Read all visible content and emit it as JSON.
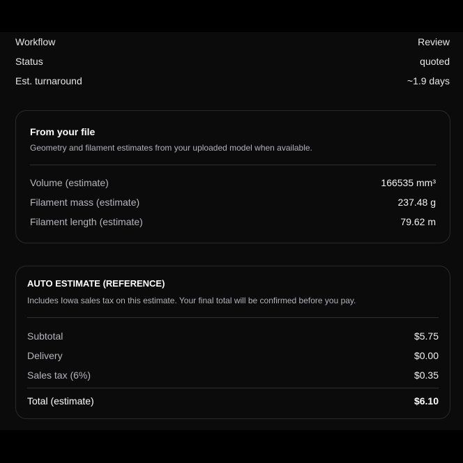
{
  "summary": {
    "rows": [
      {
        "label": "Workflow",
        "value": "Review"
      },
      {
        "label": "Status",
        "value": "quoted"
      },
      {
        "label": "Est. turnaround",
        "value": "~1.9 days"
      }
    ]
  },
  "file_card": {
    "title": "From your file",
    "subtitle": "Geometry and filament estimates from your uploaded model when available.",
    "rows": [
      {
        "label": "Volume (estimate)",
        "value": "166535 mm³"
      },
      {
        "label": "Filament mass (estimate)",
        "value": "237.48 g"
      },
      {
        "label": "Filament length (estimate)",
        "value": "79.62 m"
      }
    ]
  },
  "estimate_card": {
    "title": "AUTO ESTIMATE (REFERENCE)",
    "subtitle": "Includes Iowa sales tax on this estimate. Your final total will be confirmed before you pay.",
    "rows": [
      {
        "label": "Subtotal",
        "value": "$5.75"
      },
      {
        "label": "Delivery",
        "value": "$0.00"
      },
      {
        "label": "Sales tax (6%)",
        "value": "$0.35"
      }
    ],
    "total": {
      "label": "Total (estimate)",
      "value": "$6.10"
    }
  }
}
